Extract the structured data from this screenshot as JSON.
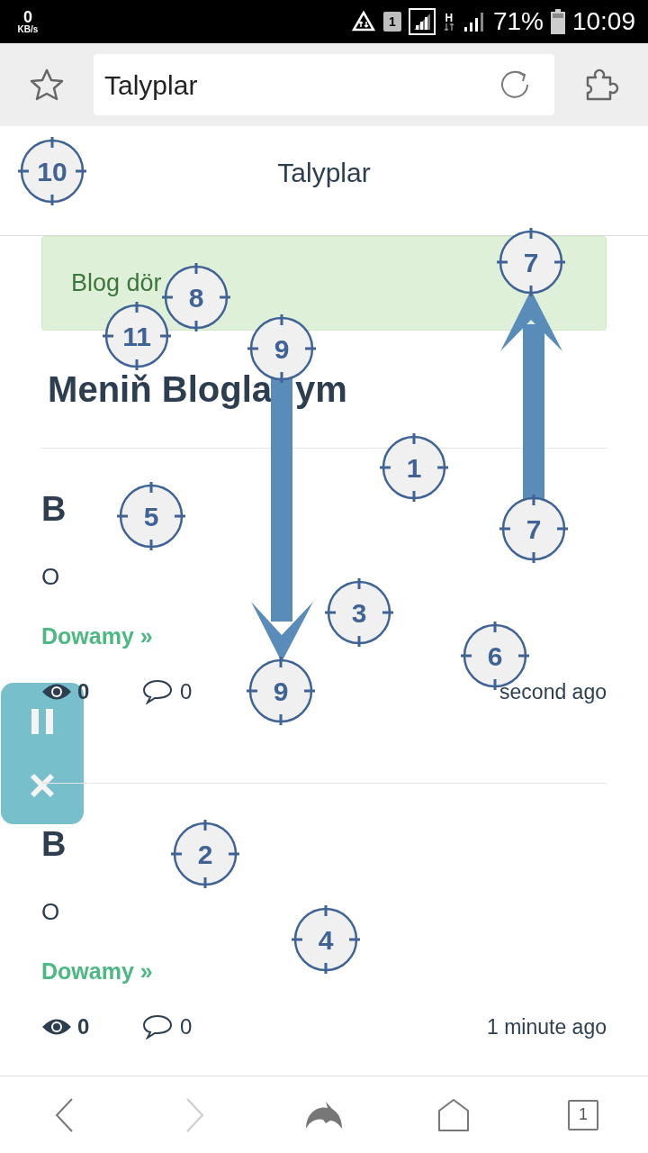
{
  "status_bar": {
    "speed_value": "0",
    "speed_unit": "KB/s",
    "sim_badge": "1",
    "network_type": "H",
    "battery": "71%",
    "time": "10:09"
  },
  "browser": {
    "address": "Talyplar",
    "tab_count": "1"
  },
  "page": {
    "title": "Talyplar",
    "alert": "Blog dör",
    "heading_parts": [
      "Meniň Blogla",
      "ym"
    ],
    "posts": [
      {
        "title": "B",
        "excerpt": "O",
        "link": "Dowamy »",
        "views": "0",
        "comments": "0",
        "time": "second ago"
      },
      {
        "title": "B",
        "excerpt": "O",
        "link": "Dowamy »",
        "views": "0",
        "comments": "0",
        "time": "1 minute ago"
      }
    ]
  },
  "click_targets": [
    {
      "label": "10"
    },
    {
      "label": "7"
    },
    {
      "label": "8"
    },
    {
      "label": "11"
    },
    {
      "label": "9"
    },
    {
      "label": "1"
    },
    {
      "label": "5"
    },
    {
      "label": "7"
    },
    {
      "label": "3"
    },
    {
      "label": "6"
    },
    {
      "label": "9"
    },
    {
      "label": "2"
    },
    {
      "label": "4"
    }
  ]
}
